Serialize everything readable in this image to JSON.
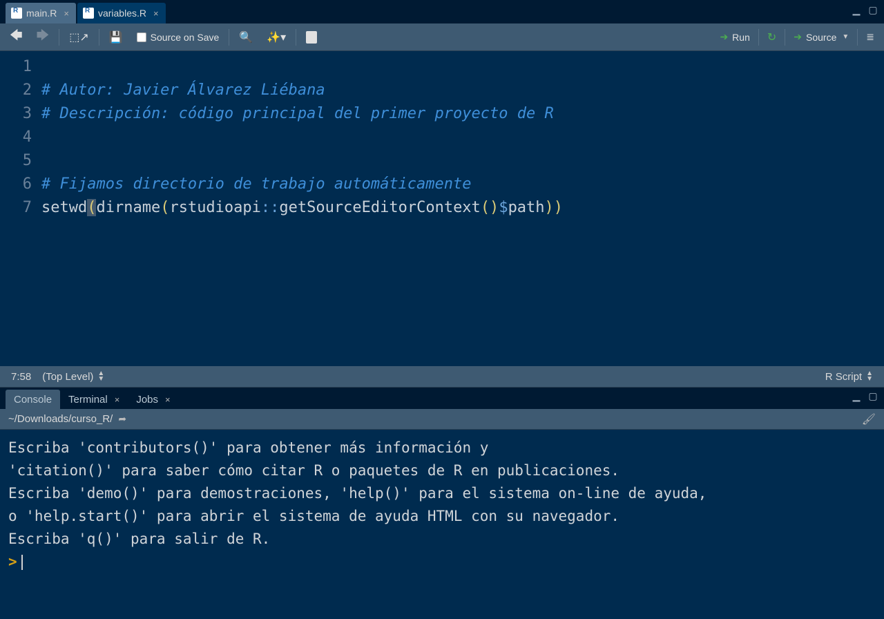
{
  "tabs": [
    {
      "label": "main.R",
      "active": true
    },
    {
      "label": "variables.R",
      "active": false
    }
  ],
  "toolbar": {
    "source_on_save": "Source on Save",
    "run": "Run",
    "source": "Source"
  },
  "code_lines": [
    {
      "type": "blank"
    },
    {
      "type": "comment",
      "text": "# Autor: Javier Álvarez Liébana"
    },
    {
      "type": "comment",
      "text": "# Descripción: código principal del primer proyecto de R"
    },
    {
      "type": "blank"
    },
    {
      "type": "blank"
    },
    {
      "type": "comment",
      "text": "# Fijamos directorio de trabajo automáticamente"
    },
    {
      "type": "code"
    }
  ],
  "code7": {
    "setwd": "setwd",
    "dirname": "dirname",
    "ns": "rstudioapi",
    "colcol": "::",
    "fn": "getSourceEditorContext",
    "dollar": "$",
    "path": "path"
  },
  "status": {
    "pos": "7:58",
    "scope": "(Top Level)",
    "lang": "R Script"
  },
  "panel_tabs": [
    {
      "label": "Console",
      "active": true,
      "closable": false
    },
    {
      "label": "Terminal",
      "active": false,
      "closable": true
    },
    {
      "label": "Jobs",
      "active": false,
      "closable": true
    }
  ],
  "console_path": "~/Downloads/curso_R/",
  "console_lines": [
    "Escriba 'contributors()' para obtener más información y",
    "'citation()' para saber cómo citar R o paquetes de R en publicaciones.",
    "",
    "Escriba 'demo()' para demostraciones, 'help()' para el sistema on-line de ayuda,",
    "o 'help.start()' para abrir el sistema de ayuda HTML con su navegador.",
    "Escriba 'q()' para salir de R.",
    ""
  ],
  "prompt": ">"
}
